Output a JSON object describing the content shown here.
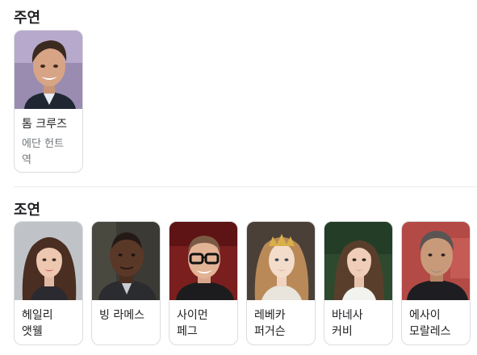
{
  "main_cast": {
    "title": "주연",
    "people": [
      {
        "name": "톰 크루즈",
        "role": "에단 헌트 역"
      }
    ]
  },
  "supporting_cast": {
    "title": "조연",
    "people": [
      {
        "name": "헤일리 앳웰"
      },
      {
        "name": "빙 라메스"
      },
      {
        "name": "사이먼 페그"
      },
      {
        "name": "레베카 퍼거슨"
      },
      {
        "name": "바네사 커비"
      },
      {
        "name": "에사이 모랄레스"
      }
    ]
  },
  "colors": {
    "text": "#202124",
    "secondary_text": "#70757a",
    "card_border": "#dadce0"
  }
}
